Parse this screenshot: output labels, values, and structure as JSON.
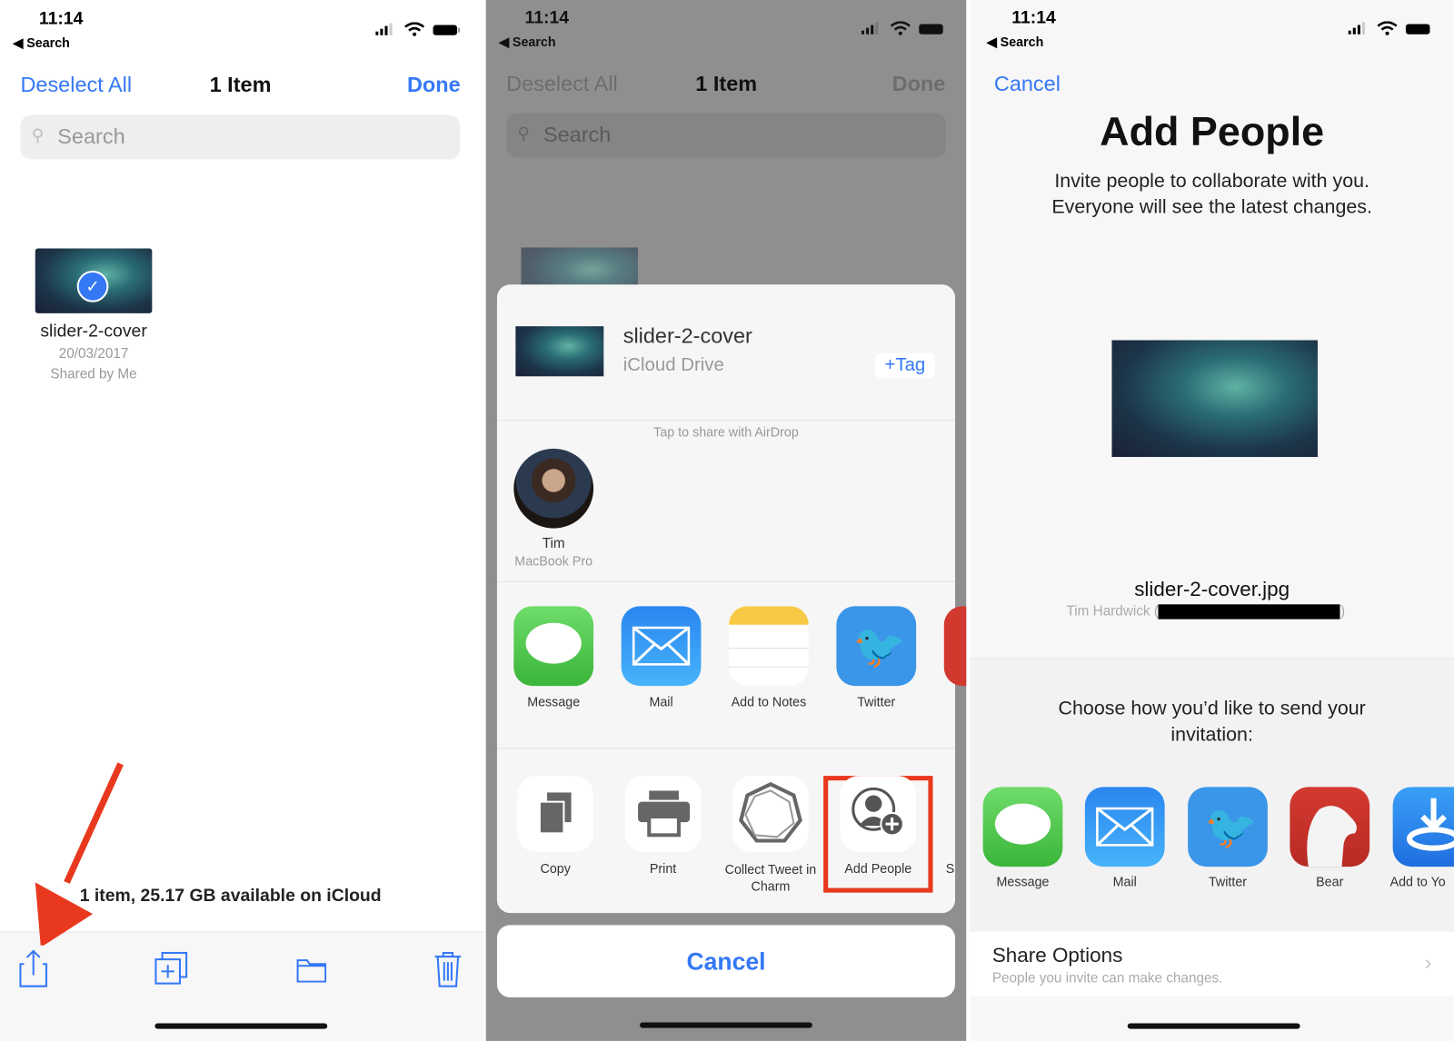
{
  "colors": {
    "accent": "#3478f6",
    "highlight": "#e8391e",
    "arrow": "#e8391e"
  },
  "status_bar": {
    "time": "11:14",
    "back_label": "Search",
    "icons": [
      "signal-icon",
      "wifi-icon",
      "battery-icon"
    ]
  },
  "panel1": {
    "nav": {
      "left": "Deselect All",
      "title": "1 Item",
      "right": "Done"
    },
    "search_placeholder": "Search",
    "file": {
      "name": "slider-2-cover",
      "date": "20/03/2017",
      "shared": "Shared by Me",
      "selected": true
    },
    "footer_text": "1 item, 25.17 GB available on iCloud",
    "toolbar": [
      "share-icon",
      "duplicate-icon",
      "folder-icon",
      "trash-icon"
    ]
  },
  "panel2": {
    "nav": {
      "left": "Deselect All",
      "title": "1 Item",
      "right": "Done"
    },
    "search_placeholder": "Search",
    "sheet": {
      "file_name": "slider-2-cover",
      "location": "iCloud Drive",
      "tag_button": "+Tag",
      "airdrop_hint": "Tap to share with AirDrop",
      "airdrop_person": {
        "name": "Tim",
        "device": "MacBook Pro"
      },
      "apps": [
        "Message",
        "Mail",
        "Add to Notes",
        "Twitter"
      ],
      "actions": [
        "Copy",
        "Print",
        "Collect Tweet in Charm",
        "Add People"
      ],
      "action_partial": "S",
      "highlighted_action": "Add People"
    },
    "cancel": "Cancel"
  },
  "panel3": {
    "cancel": "Cancel",
    "title": "Add People",
    "subtitle_line1": "Invite people to collaborate with you.",
    "subtitle_line2": "Everyone will see the latest changes.",
    "file_name": "slider-2-cover.jpg",
    "owner": "Tim Hardwick (",
    "owner_close": ")",
    "choose_line1": "Choose how you’d like to send your",
    "choose_line2": "invitation:",
    "apps": [
      "Message",
      "Mail",
      "Twitter",
      "Bear",
      "Add to Yo"
    ],
    "share_options": {
      "title": "Share Options",
      "subtitle": "People you invite can make changes."
    }
  }
}
